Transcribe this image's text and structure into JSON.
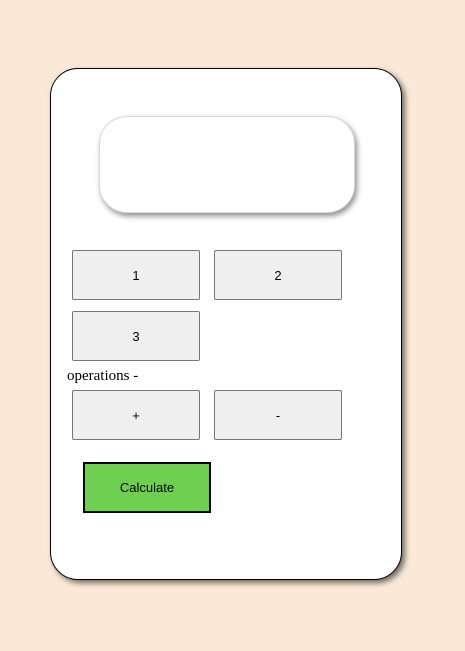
{
  "display": {
    "value": ""
  },
  "keypad": {
    "digits": [
      "1",
      "2",
      "3"
    ]
  },
  "operations": {
    "label": "operations -",
    "keys": [
      "+",
      "-"
    ]
  },
  "actions": {
    "calculate_label": "Calculate"
  },
  "colors": {
    "page_background": "#fae9d6",
    "calculate_button": "#6dd04f",
    "key_background": "#efefef"
  }
}
